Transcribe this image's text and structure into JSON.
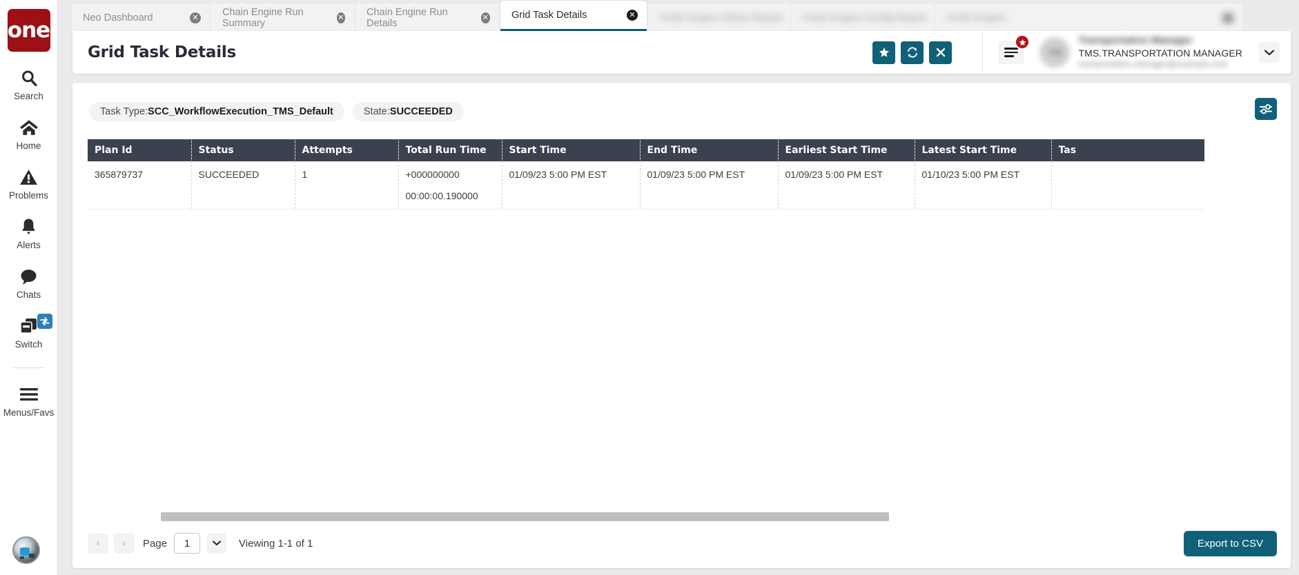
{
  "app": {
    "logo_text": "one",
    "brand_color": "#9d1016",
    "accent_color": "#11607a",
    "header_bar_color": "#3b414e"
  },
  "sidebar": {
    "items": [
      {
        "label": "Search",
        "icon": "search-icon"
      },
      {
        "label": "Home",
        "icon": "home-icon"
      },
      {
        "label": "Problems",
        "icon": "warning-triangle-icon"
      },
      {
        "label": "Alerts",
        "icon": "bell-icon"
      },
      {
        "label": "Chats",
        "icon": "chat-bubble-icon"
      },
      {
        "label": "Switch",
        "icon": "switch-windows-icon",
        "badge_icon": "swap-arrows-icon"
      },
      {
        "label": "Menus/Favs",
        "icon": "hamburger-icon"
      }
    ],
    "bottom_icon": "globe-icon"
  },
  "tabs": [
    {
      "label": "Neo Dashboard",
      "active": false,
      "blurred": false,
      "close_icon": "close-circle-icon"
    },
    {
      "label": "Chain Engine Run Summary",
      "active": false,
      "blurred": false,
      "close_icon": "close-circle-icon"
    },
    {
      "label": "Chain Engine Run Details",
      "active": false,
      "blurred": false,
      "close_icon": "close-circle-icon"
    },
    {
      "label": "Grid Task Details",
      "active": true,
      "blurred": false,
      "close_icon": "close-circle-icon"
    },
    {
      "label": "Order Engine Status Report",
      "active": false,
      "blurred": true,
      "close_icon": "close-circle-icon"
    },
    {
      "label": "Chain Engine Config Report",
      "active": false,
      "blurred": true,
      "close_icon": "close-circle-icon"
    },
    {
      "label": "Order Engine",
      "active": false,
      "blurred": true,
      "close_icon": "close-circle-icon"
    }
  ],
  "header": {
    "title": "Grid Task Details",
    "actions": [
      {
        "name": "favorite-button",
        "icon": "star-icon",
        "glyph": "★"
      },
      {
        "name": "refresh-button",
        "icon": "refresh-icon",
        "glyph": "↻"
      },
      {
        "name": "close-button",
        "icon": "x-icon",
        "glyph": "✕"
      }
    ],
    "menu_icon": "hamburger-menu-icon",
    "menu_badge_icon": "star-badge-icon",
    "menu_badge_glyph": "★",
    "user": {
      "avatar_initials": "TM",
      "name": "Transportation  Manager",
      "role": "TMS.TRANSPORTATION  MANAGER",
      "email": "transportation.manager@example.com"
    },
    "caret_icon": "chevron-down-icon",
    "caret_glyph": "⌄"
  },
  "panel": {
    "chips": [
      {
        "name": "task-type-chip",
        "label": "Task Type:",
        "value": "SCC_WorkflowExecution_TMS_Default"
      },
      {
        "name": "state-chip",
        "label": "State:",
        "value": "SUCCEEDED"
      }
    ],
    "filter_icon": "sliders-icon"
  },
  "table": {
    "columns": [
      "Plan Id",
      "Status",
      "Attempts",
      "Total Run Time",
      "Start Time",
      "End Time",
      "Earliest Start Time",
      "Latest Start Time",
      "Tas"
    ],
    "rows": [
      {
        "plan_id": "365879737",
        "status": "SUCCEEDED",
        "attempts": "1",
        "total_run_time_line1": "+000000000",
        "total_run_time_line2": "00:00:00.190000",
        "start_time": "01/09/23 5:00 PM EST",
        "end_time": "01/09/23 5:00 PM EST",
        "earliest_start_time": "01/09/23 5:00 PM EST",
        "latest_start_time": "01/10/23 5:00 PM EST",
        "task_truncated": ""
      }
    ]
  },
  "footer": {
    "prev_glyph": "‹",
    "next_glyph": "›",
    "page_label": "Page",
    "page_value": "1",
    "page_caret_glyph": "⌄",
    "viewing_text": "Viewing 1-1 of 1",
    "export_label": "Export to CSV"
  }
}
